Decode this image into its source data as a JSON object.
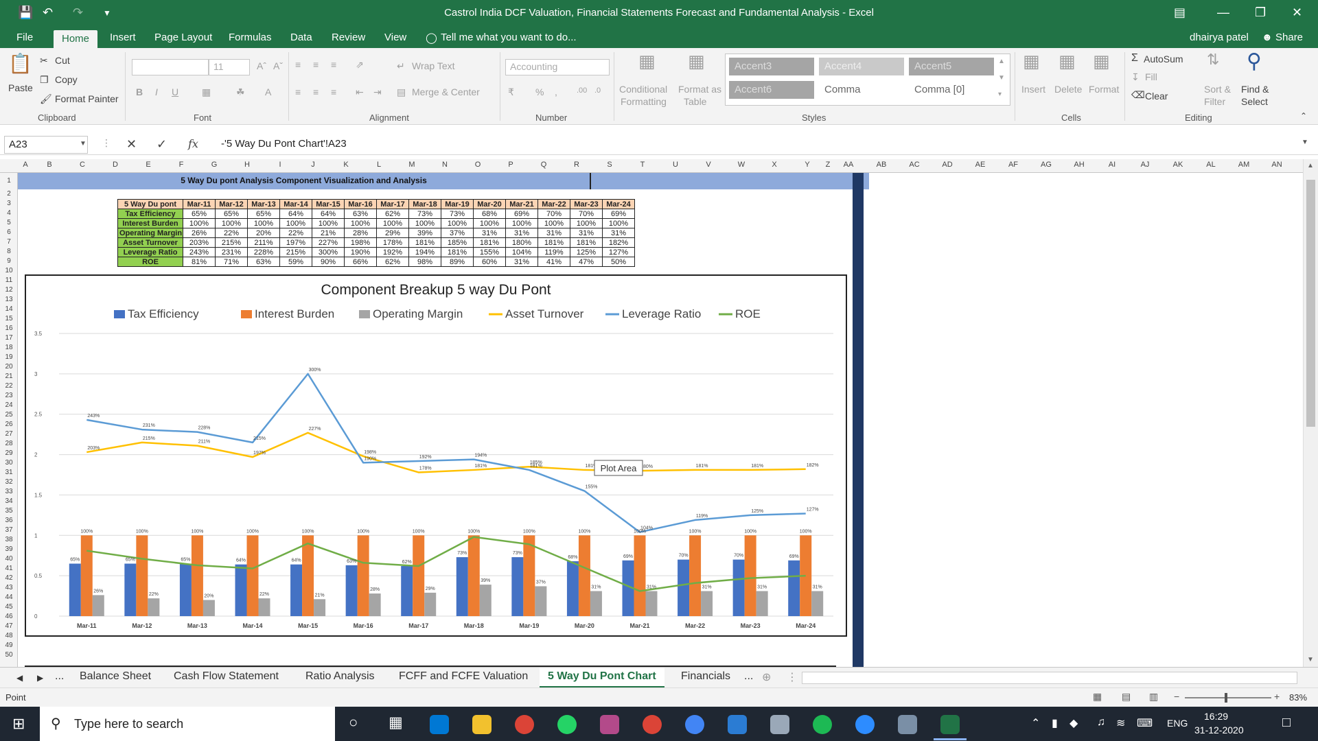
{
  "window": {
    "title": "Castrol India DCF Valuation, Financial Statements Forecast and Fundamental Analysis - Excel",
    "user": "dhairya patel",
    "share": "Share"
  },
  "ribbon": {
    "tabs": [
      "File",
      "Home",
      "Insert",
      "Page Layout",
      "Formulas",
      "Data",
      "Review",
      "View"
    ],
    "tell_me": "Tell me what you want to do...",
    "clipboard": {
      "paste": "Paste",
      "cut": "Cut",
      "copy": "Copy",
      "format_painter": "Format Painter",
      "label": "Clipboard"
    },
    "font": {
      "size": "11",
      "label": "Font"
    },
    "alignment": {
      "wrap": "Wrap Text",
      "merge": "Merge & Center",
      "label": "Alignment"
    },
    "number": {
      "format": "Accounting",
      "label": "Number"
    },
    "styles": {
      "conditional": "Conditional",
      "formatting": "Formatting",
      "format_as": "Format as",
      "table": "Table",
      "boxes": [
        "Accent3",
        "Accent4",
        "Accent5",
        "Accent6",
        "Comma",
        "Comma [0]"
      ],
      "label": "Styles"
    },
    "cells": {
      "insert": "Insert",
      "delete": "Delete",
      "format": "Format",
      "label": "Cells"
    },
    "editing": {
      "autosum": "AutoSum",
      "fill": "Fill",
      "clear": "Clear",
      "sort": "Sort &",
      "filter": "Filter",
      "find": "Find &",
      "select": "Select",
      "label": "Editing"
    }
  },
  "formula_bar": {
    "namebox": "A23",
    "formula": "-'5 Way Du Pont Chart'!A23"
  },
  "columns": [
    "A",
    "B",
    "C",
    "D",
    "E",
    "F",
    "G",
    "H",
    "I",
    "J",
    "K",
    "L",
    "M",
    "N",
    "O",
    "P",
    "Q",
    "R",
    "S",
    "T",
    "U",
    "V",
    "W",
    "X",
    "Y",
    "Z",
    "AA",
    "AB",
    "AC",
    "AD",
    "AE",
    "AF",
    "AG",
    "AH",
    "AI",
    "AJ",
    "AK",
    "AL",
    "AM",
    "AN"
  ],
  "sheet": {
    "header_title": "5 Way Du pont Analysis Component Visualization and Analysis",
    "table": {
      "corner": "5 Way Du pont",
      "years": [
        "Mar-11",
        "Mar-12",
        "Mar-13",
        "Mar-14",
        "Mar-15",
        "Mar-16",
        "Mar-17",
        "Mar-18",
        "Mar-19",
        "Mar-20",
        "Mar-21",
        "Mar-22",
        "Mar-23",
        "Mar-24"
      ],
      "rows": [
        {
          "label": "Tax Efficiency",
          "values": [
            "65%",
            "65%",
            "65%",
            "64%",
            "64%",
            "63%",
            "62%",
            "73%",
            "73%",
            "68%",
            "69%",
            "70%",
            "70%",
            "69%"
          ]
        },
        {
          "label": "Interest Burden",
          "values": [
            "100%",
            "100%",
            "100%",
            "100%",
            "100%",
            "100%",
            "100%",
            "100%",
            "100%",
            "100%",
            "100%",
            "100%",
            "100%",
            "100%"
          ]
        },
        {
          "label": "Operating Margin",
          "values": [
            "26%",
            "22%",
            "20%",
            "22%",
            "21%",
            "28%",
            "29%",
            "39%",
            "37%",
            "31%",
            "31%",
            "31%",
            "31%",
            "31%"
          ]
        },
        {
          "label": "Asset Turnover",
          "values": [
            "203%",
            "215%",
            "211%",
            "197%",
            "227%",
            "198%",
            "178%",
            "181%",
            "185%",
            "181%",
            "180%",
            "181%",
            "181%",
            "182%"
          ]
        },
        {
          "label": "Leverage Ratio",
          "values": [
            "243%",
            "231%",
            "228%",
            "215%",
            "300%",
            "190%",
            "192%",
            "194%",
            "181%",
            "155%",
            "104%",
            "119%",
            "125%",
            "127%"
          ]
        },
        {
          "label": "ROE",
          "values": [
            "81%",
            "71%",
            "63%",
            "59%",
            "90%",
            "66%",
            "62%",
            "98%",
            "89%",
            "60%",
            "31%",
            "41%",
            "47%",
            "50%"
          ]
        }
      ]
    },
    "tooltip": "Plot Area"
  },
  "chart_data": {
    "type": "bar",
    "title": "Component Breakup 5 way Du Pont",
    "categories": [
      "Mar-11",
      "Mar-12",
      "Mar-13",
      "Mar-14",
      "Mar-15",
      "Mar-16",
      "Mar-17",
      "Mar-18",
      "Mar-19",
      "Mar-20",
      "Mar-21",
      "Mar-22",
      "Mar-23",
      "Mar-24"
    ],
    "ylim": [
      0,
      3.5
    ],
    "yticks": [
      "0",
      "0.5",
      "1",
      "1.5",
      "2",
      "2.5",
      "3",
      "3.5"
    ],
    "legend_position": "top",
    "grid": true,
    "series": [
      {
        "name": "Tax Efficiency",
        "kind": "bar",
        "color": "#4472c4",
        "values": [
          0.65,
          0.65,
          0.65,
          0.64,
          0.64,
          0.63,
          0.62,
          0.73,
          0.73,
          0.68,
          0.69,
          0.7,
          0.7,
          0.69
        ],
        "labels": [
          "65%",
          "65%",
          "65%",
          "64%",
          "64%",
          "63%",
          "62%",
          "73%",
          "73%",
          "68%",
          "69%",
          "70%",
          "70%",
          "69%"
        ]
      },
      {
        "name": "Interest Burden",
        "kind": "bar",
        "color": "#ed7d31",
        "values": [
          1,
          1,
          1,
          1,
          1,
          1,
          1,
          1,
          1,
          1,
          1,
          1,
          1,
          1
        ],
        "labels": [
          "100%",
          "100%",
          "100%",
          "100%",
          "100%",
          "100%",
          "100%",
          "100%",
          "100%",
          "100%",
          "100%",
          "100%",
          "100%",
          "100%"
        ]
      },
      {
        "name": "Operating Margin",
        "kind": "bar",
        "color": "#a5a5a5",
        "values": [
          0.26,
          0.22,
          0.2,
          0.22,
          0.21,
          0.28,
          0.29,
          0.39,
          0.37,
          0.31,
          0.31,
          0.31,
          0.31,
          0.31
        ],
        "labels": [
          "26%",
          "22%",
          "20%",
          "22%",
          "21%",
          "28%",
          "29%",
          "39%",
          "37%",
          "31%",
          "31%",
          "31%",
          "31%",
          "31%"
        ]
      },
      {
        "name": "Asset Turnover",
        "kind": "line",
        "color": "#ffc000",
        "values": [
          2.03,
          2.15,
          2.11,
          1.97,
          2.27,
          1.98,
          1.78,
          1.81,
          1.85,
          1.81,
          1.8,
          1.81,
          1.81,
          1.82
        ],
        "labels": [
          "203%",
          "215%",
          "211%",
          "197%",
          "227%",
          "198%",
          "178%",
          "181%",
          "185%",
          "181%",
          "180%",
          "181%",
          "181%",
          "182%"
        ]
      },
      {
        "name": "Leverage Ratio",
        "kind": "line",
        "color": "#5b9bd5",
        "values": [
          2.43,
          2.31,
          2.28,
          2.15,
          3.0,
          1.9,
          1.92,
          1.94,
          1.81,
          1.55,
          1.04,
          1.19,
          1.25,
          1.27
        ],
        "labels": [
          "243%",
          "231%",
          "228%",
          "215%",
          "300%",
          "190%",
          "192%",
          "194%",
          "181%",
          "155%",
          "104%",
          "119%",
          "125%",
          "127%"
        ]
      },
      {
        "name": "ROE",
        "kind": "line",
        "color": "#70ad47",
        "values": [
          0.81,
          0.71,
          0.63,
          0.59,
          0.9,
          0.66,
          0.62,
          0.98,
          0.89,
          0.6,
          0.31,
          0.41,
          0.47,
          0.5
        ],
        "labels": []
      }
    ]
  },
  "sheet_tabs": {
    "ellipsis": "...",
    "tabs": [
      "Balance Sheet",
      "Cash Flow Statement",
      "Ratio Analysis",
      "FCFF and FCFE Valuation",
      "5 Way Du Pont Chart",
      "Financials"
    ],
    "active": "5 Way Du Pont Chart",
    "more": "..."
  },
  "status": {
    "mode": "Point",
    "zoom": "83%"
  },
  "taskbar": {
    "search": "Type here to search",
    "lang": "ENG",
    "time": "16:29",
    "date": "31-12-2020"
  }
}
